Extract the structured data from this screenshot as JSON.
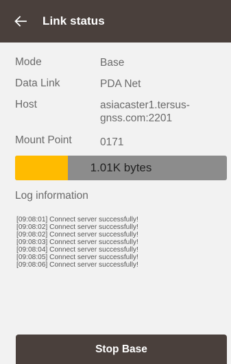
{
  "app_bar": {
    "title": "Link status",
    "back_icon": "arrow-left-icon",
    "background": "#4a403c"
  },
  "details": [
    {
      "label": "Mode",
      "value": "Base"
    },
    {
      "label": "Data Link",
      "value": "PDA Net"
    },
    {
      "label": "Host",
      "value": "asiacaster1.tersus-gnss.com:2201"
    },
    {
      "label": "Mount Point",
      "value": "0171"
    }
  ],
  "progress": {
    "text": "1.01K bytes",
    "fill_fraction": 0.25,
    "fill_color": "#ffbb00",
    "track_color": "#8c8c8c"
  },
  "log": {
    "title": "Log information",
    "lines": [
      "[09:08:01] Connect server successfully!",
      "[09:08:02] Connect server successfully!",
      "[09:08:02] Connect server successfully!",
      "[09:08:03] Connect server successfully!",
      "[09:08:04] Connect server successfully!",
      "[09:08:05] Connect server successfully!",
      "[09:08:06] Connect server successfully!"
    ]
  },
  "actions": {
    "stop_label": "Stop Base"
  }
}
